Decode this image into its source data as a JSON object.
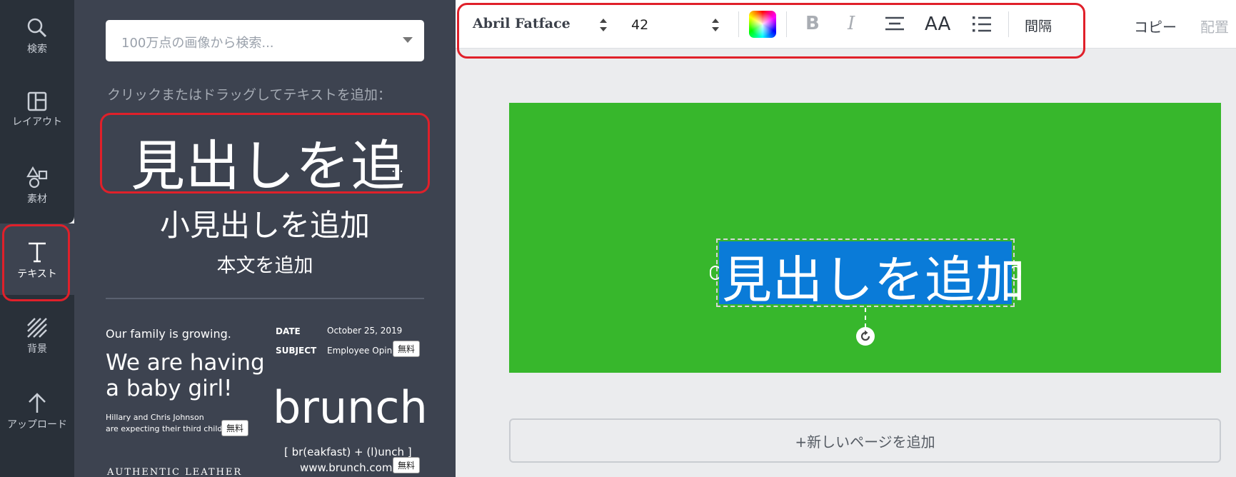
{
  "rail": {
    "items": [
      {
        "label": "検索",
        "icon": "search-icon"
      },
      {
        "label": "レイアウト",
        "icon": "layout-icon"
      },
      {
        "label": "素材",
        "icon": "elements-icon"
      },
      {
        "label": "テキスト",
        "icon": "text-icon",
        "active": true
      },
      {
        "label": "背景",
        "icon": "background-icon"
      },
      {
        "label": "アップロード",
        "icon": "upload-icon"
      }
    ]
  },
  "panel": {
    "search_placeholder": "100万点の画像から検索...",
    "hint": "クリックまたはドラッグしてテキストを追加：",
    "heading": "見出しを追",
    "heading_ellipsis": "...",
    "subheading": "小見出しを追加",
    "body": "本文を追加",
    "templates": {
      "family": {
        "line1": "Our family is growing.",
        "line2": "We are having",
        "line3": "a baby girl!",
        "line4": "Hillary and Chris Johnson",
        "line5": "are expecting their third child",
        "badge": "無料"
      },
      "memo": {
        "date_label": "DATE",
        "date_value": "October 25, 2019",
        "subject_label": "SUBJECT",
        "subject_value": "Employee Opinio",
        "badge": "無料"
      },
      "brunch": {
        "title": "brunch",
        "tagline": "[ br(eakfast) + (l)unch ]",
        "url": "www.brunch.com",
        "badge": "無料"
      },
      "leather": {
        "title": "AUTHENTIC LEATHER"
      }
    }
  },
  "toolbar": {
    "font": "Abril Fatface",
    "size": "42",
    "bold": "B",
    "italic": "I",
    "case": "AA",
    "spacing": "間隔",
    "copy": "コピー",
    "arrange": "配置"
  },
  "canvas": {
    "selected_text": "見出しを追加",
    "background": "#37b72c",
    "selection_color": "#0a7bd8"
  },
  "add_page": "+新しいページを追加",
  "colors": {
    "highlight": "#e0202a",
    "panel_bg": "#3d4350",
    "rail_bg": "#293039"
  }
}
